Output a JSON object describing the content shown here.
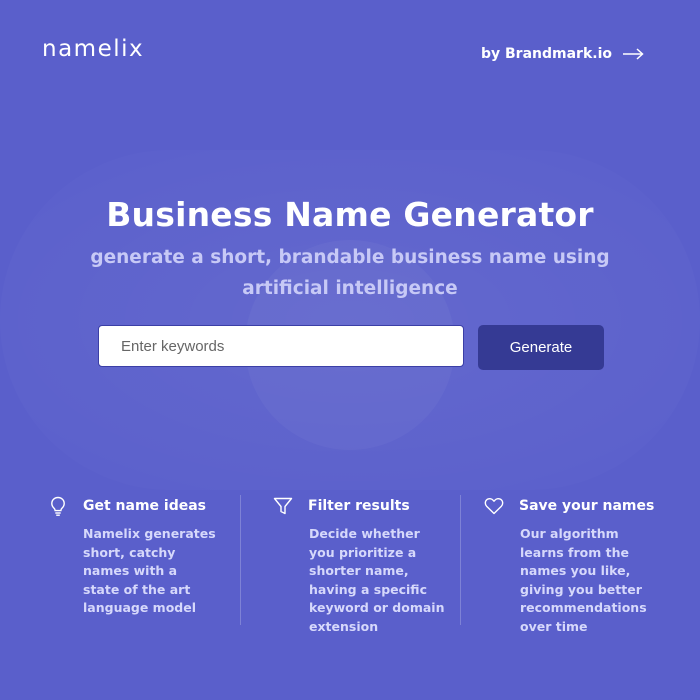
{
  "header": {
    "logo_text": "namelix",
    "by_link": "by Brandmark.io"
  },
  "hero": {
    "title": "Business Name Generator",
    "subtitle": "generate a short, brandable business name using artificial intelligence"
  },
  "search": {
    "placeholder": "Enter keywords",
    "value": "",
    "button_label": "Generate"
  },
  "features": [
    {
      "icon": "lightbulb-icon",
      "title": "Get name ideas",
      "description": "Namelix generates short, catchy names with a state of the art language model"
    },
    {
      "icon": "filter-icon",
      "title": "Filter results",
      "description": "Decide whether you prioritize a shorter name, having a specific keyword or domain extension"
    },
    {
      "icon": "heart-icon",
      "title": "Save your names",
      "description": "Our algorithm learns from the names you like, giving you better recommendations over time"
    }
  ],
  "colors": {
    "background": "#5a5fcb",
    "button": "#353a94",
    "subtitle": "#c7c9f6"
  }
}
